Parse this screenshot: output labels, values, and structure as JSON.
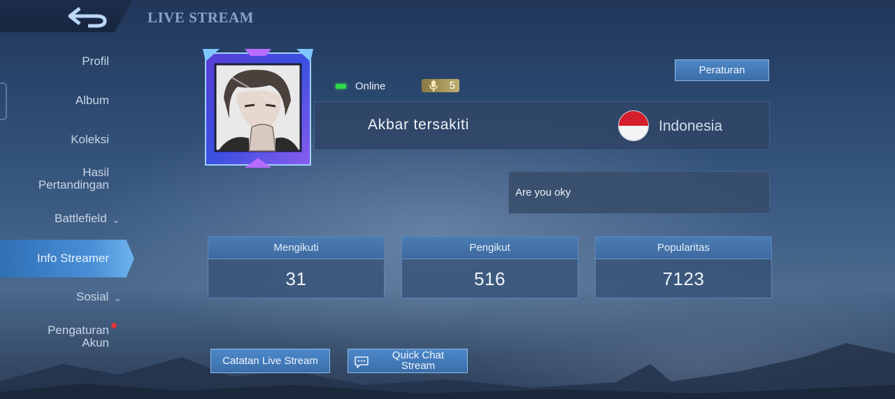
{
  "header": {
    "title": "LIVE STREAM",
    "back_icon": "back-arrow-icon"
  },
  "sidebar": {
    "items": [
      {
        "label": "Profil"
      },
      {
        "label": "Album"
      },
      {
        "label": "Koleksi"
      },
      {
        "label": "Hasil",
        "label2": "Pertandingan"
      },
      {
        "label": "Battlefield",
        "expandable": true
      },
      {
        "label": "Info Streamer",
        "active": true
      },
      {
        "label": "Sosial",
        "expandable": true
      },
      {
        "label": "Pengaturan",
        "label2": "Akun",
        "notification": true
      }
    ]
  },
  "profile": {
    "status": "Online",
    "status_color": "#33d84a",
    "mic_level": "5",
    "name": "Akbar tersakiti",
    "country": "Indonesia",
    "bio": "Are you oky"
  },
  "rules_button": "Peraturan",
  "stats": [
    {
      "label": "Mengikuti",
      "value": "31"
    },
    {
      "label": "Pengikut",
      "value": "516"
    },
    {
      "label": "Popularitas",
      "value": "7123"
    }
  ],
  "buttons": {
    "log": "Catatan Live Stream",
    "quick_chat_line1": "Quick Chat",
    "quick_chat_line2": "Stream"
  },
  "colors": {
    "accent": "#4a90d6",
    "notification": "#e0343a"
  }
}
